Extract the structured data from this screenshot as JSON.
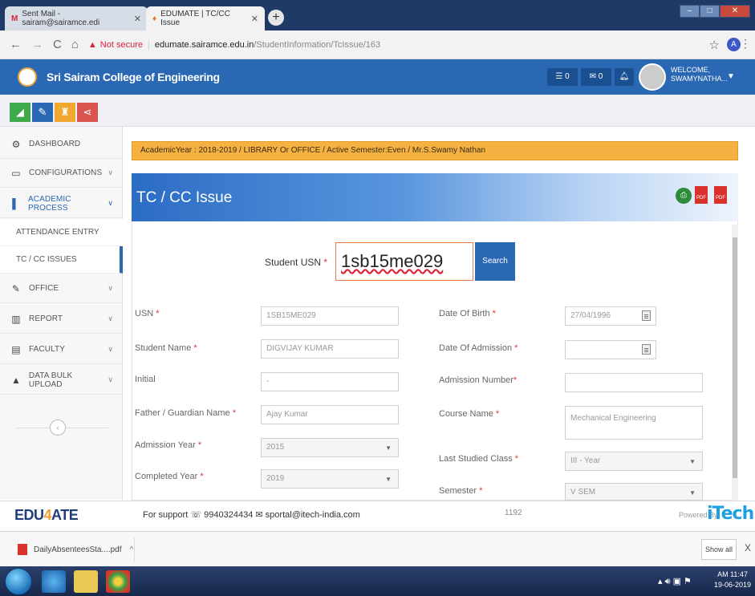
{
  "browser": {
    "tabs": [
      {
        "label": "Sent Mail - sairam@sairamce.edi",
        "icon": "gmail-icon"
      },
      {
        "label": "EDUMATE | TC/CC Issue",
        "icon": "edumate-favicon"
      }
    ],
    "new_tab": "+",
    "not_secure": "Not secure",
    "url_host": "edumate.sairamce.edu.in",
    "url_path": "/StudentInformation/TcIssue/163",
    "profile": "A"
  },
  "header": {
    "college": "Sri Sairam College of Engineering",
    "msg_count": "0",
    "mail_count": "0",
    "welcome": "WELCOME,",
    "user": "SWAMYNATHA..."
  },
  "sidebar": {
    "items": [
      {
        "label": "DASHBOARD"
      },
      {
        "label": "CONFIGURATIONS"
      },
      {
        "label": "ACADEMIC PROCESS"
      },
      {
        "label": "OFFICE"
      },
      {
        "label": "REPORT"
      },
      {
        "label": "FACULTY"
      },
      {
        "label": "DATA BULK UPLOAD"
      }
    ],
    "subitems": [
      {
        "label": "ATTENDANCE ENTRY"
      },
      {
        "label": "TC / CC ISSUES"
      }
    ]
  },
  "banner": "AcademicYear : 2018-2019 / LIBRARY Or OFFICE / Active Semester:Even / Mr.S.Swamy Nathan",
  "page_title": "TC / CC Issue",
  "search": {
    "label": "Student USN",
    "value": "1sb15me029",
    "button": "Search"
  },
  "form": {
    "usn": {
      "label": "USN",
      "value": "1SB15ME029"
    },
    "student_name": {
      "label": "Student Name",
      "value": "DIGVIJAY KUMAR"
    },
    "initial": {
      "label": "Initial",
      "value": "-"
    },
    "father_name": {
      "label": "Father / Guardian Name",
      "value": "Ajay Kumar"
    },
    "admission_year": {
      "label": "Admission Year",
      "value": "2015"
    },
    "completed_year": {
      "label": "Completed Year",
      "value": "2019"
    },
    "dob": {
      "label": "Date Of Birth",
      "value": "27/04/1996"
    },
    "doa": {
      "label": "Date Of Admission",
      "value": ""
    },
    "admission_number": {
      "label": "Admission Number",
      "value": ""
    },
    "course_name": {
      "label": "Course Name",
      "value": "Mechanical Engineering"
    },
    "last_class": {
      "label": "Last Studied Class",
      "value": "III - Year"
    },
    "semester": {
      "label": "Semester",
      "value": "V SEM"
    }
  },
  "footer": {
    "logo_a": "EDU",
    "logo_b": "4",
    "logo_c": "ATE",
    "support_label": "For support",
    "phone": "9940324434",
    "email": "sportal@itech-india.com",
    "count": "1192",
    "powered": "Powered By",
    "brand": "iTech"
  },
  "downloads": {
    "file": "DailyAbsenteesSta....pdf",
    "show_all": "Show all"
  },
  "taskbar": {
    "time": "AM 11:47",
    "date": "19-06-2019"
  },
  "colors": {
    "header_blue": "#2a68b4",
    "banner_orange": "#f5b141",
    "required_red": "#d33"
  }
}
